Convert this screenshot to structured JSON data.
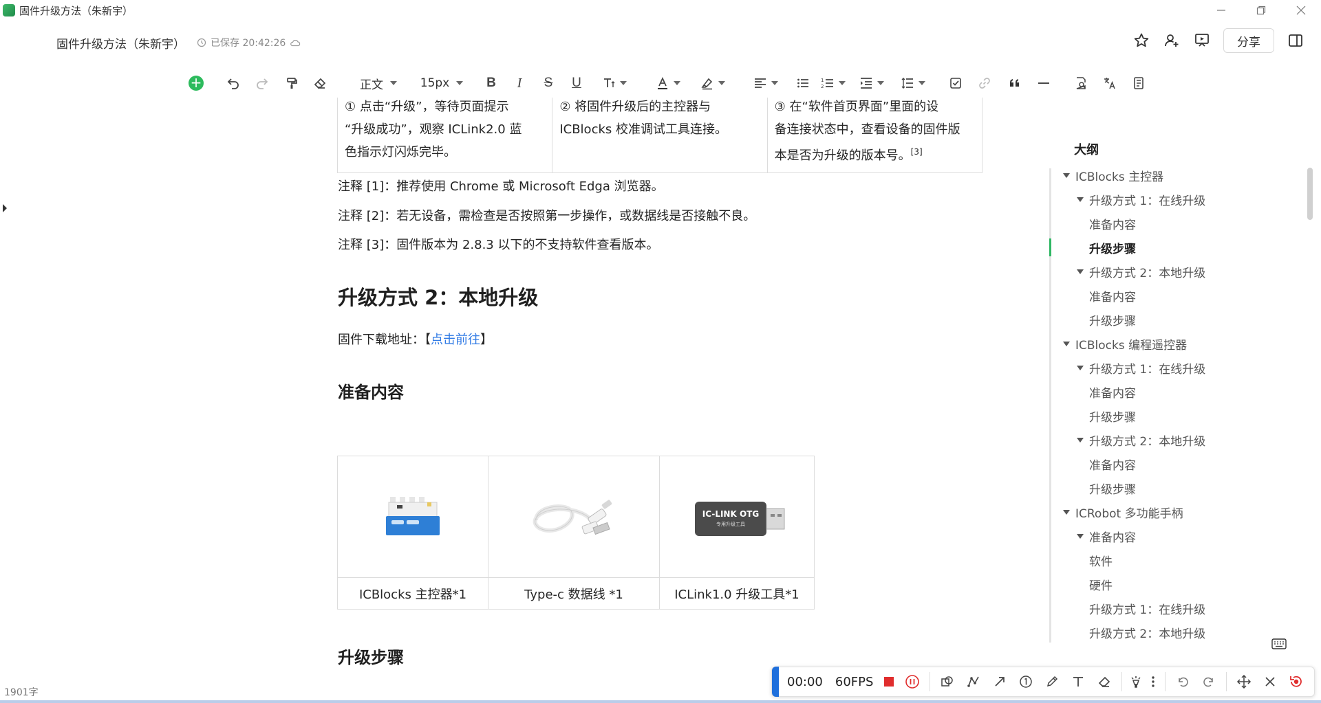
{
  "window": {
    "title": "固件升级方法（朱新宇）"
  },
  "doc": {
    "title": "固件升级方法（朱新宇）",
    "save_status": "已保存 20:42:26"
  },
  "header": {
    "share_label": "分享"
  },
  "toolbar": {
    "style_label": "正文",
    "size_label": "15px"
  },
  "top_table": {
    "cells": [
      [
        "① 点击“升级”，等待页面提示",
        "“升级成功”，观察 ICLink2.0 蓝",
        "色指示灯闪烁完毕。"
      ],
      [
        "② 将固件升级后的主控器与",
        "ICBlocks 校准调试工具连接。"
      ],
      [
        "③ 在“软件首页界面”里面的设",
        "备连接状态中，查看设备的固件版",
        "本是否为升级的版本号。"
      ]
    ],
    "sup": "[3]"
  },
  "notes": [
    "注释 [1]：推荐使用 Chrome 或 Microsoft Edga 浏览器。",
    "注释 [2]：若无设备，需检查是否按照第一步操作，或数据线是否接触不良。",
    "注释 [3]：固件版本为 2.8.3 以下的不支持软件查看版本。"
  ],
  "section": {
    "heading": "升级方式 2：本地升级",
    "download_prefix": "固件下载地址：【",
    "download_link": "点击前往",
    "download_suffix": "】",
    "prepare_heading": "准备内容",
    "steps_heading": "升级步骤"
  },
  "items": [
    {
      "caption": "ICBlocks 主控器*1",
      "image": "controller-image"
    },
    {
      "caption": "Type-c 数据线 *1",
      "image": "cable-image"
    },
    {
      "caption": "ICLink1.0 升级工具*1",
      "image": "iclink-otg-image",
      "image_text": "IC-LINK OTG",
      "image_subtext": "专用升级工具"
    }
  ],
  "outline": {
    "title": "大纲",
    "items": [
      {
        "label": "ICBlocks 主控器",
        "level": 1,
        "expanded": true
      },
      {
        "label": "升级方式 1：在线升级",
        "level": 2,
        "expanded": true
      },
      {
        "label": "准备内容",
        "level": 3
      },
      {
        "label": "升级步骤",
        "level": 3,
        "active": true
      },
      {
        "label": "升级方式 2：本地升级",
        "level": 2,
        "expanded": true
      },
      {
        "label": "准备内容",
        "level": 3
      },
      {
        "label": "升级步骤",
        "level": 3
      },
      {
        "label": "ICBlocks 编程遥控器",
        "level": 1,
        "expanded": true
      },
      {
        "label": "升级方式 1：在线升级",
        "level": 2,
        "expanded": true
      },
      {
        "label": "准备内容",
        "level": 3
      },
      {
        "label": "升级步骤",
        "level": 3
      },
      {
        "label": "升级方式 2：本地升级",
        "level": 2,
        "expanded": true
      },
      {
        "label": "准备内容",
        "level": 3
      },
      {
        "label": "升级步骤",
        "level": 3
      },
      {
        "label": "ICRobot 多功能手柄",
        "level": 1,
        "expanded": true
      },
      {
        "label": "准备内容",
        "level": 2,
        "expanded": true
      },
      {
        "label": "软件",
        "level": 3
      },
      {
        "label": "硬件",
        "level": 3
      },
      {
        "label": "升级方式 1：在线升级",
        "level": 2,
        "expanded": false
      },
      {
        "label": "升级方式 2：本地升级",
        "level": 2,
        "expanded": false
      }
    ]
  },
  "recorder": {
    "time": "00:00",
    "fps": "60FPS",
    "accent_color": "#1e6fdc",
    "stop_color": "#e02d2d"
  },
  "status": {
    "word_count": "1901字"
  },
  "colors": {
    "link": "#2f7ae5",
    "accent_green": "#2dbb5d"
  }
}
